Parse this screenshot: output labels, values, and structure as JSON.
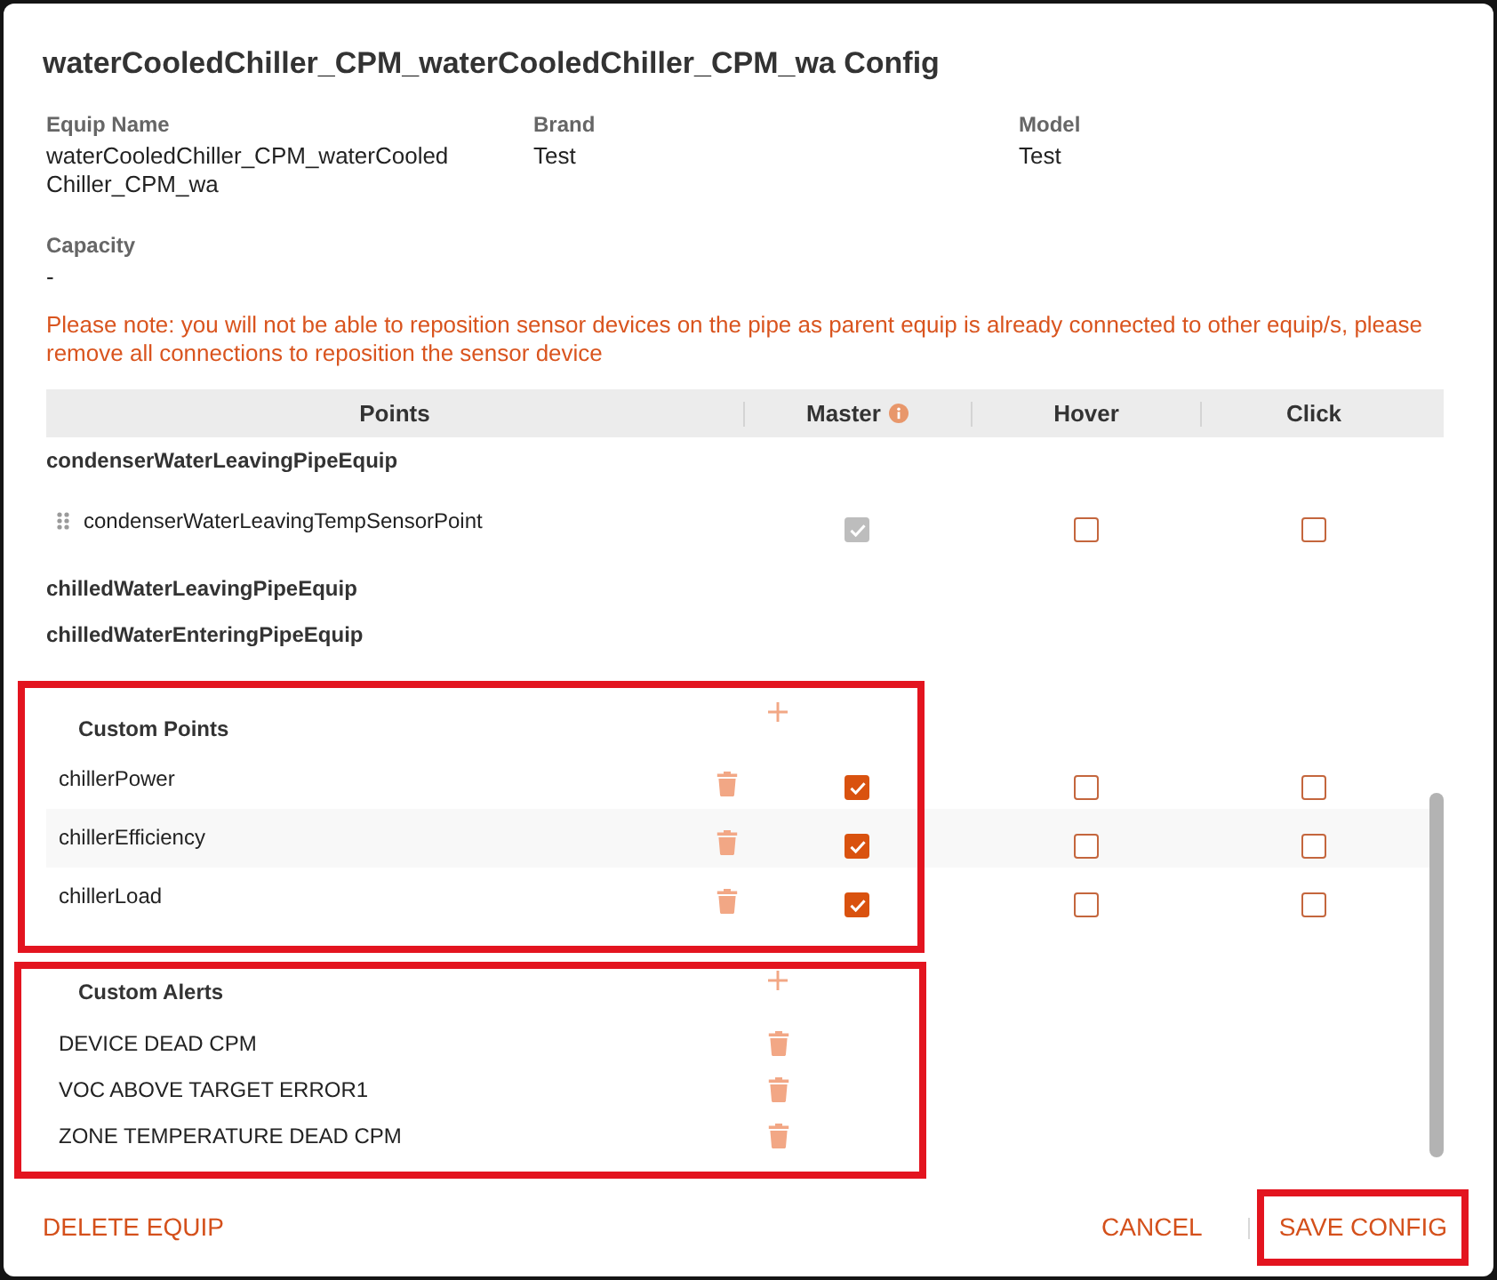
{
  "dialog": {
    "title": "waterCooledChiller_CPM_waterCooledChiller_CPM_wa Config"
  },
  "details": [
    {
      "label": "Equip Name",
      "value": "waterCooledChiller_CPM_waterCooledChiller_CPM_wa"
    },
    {
      "label": "Brand",
      "value": "Test"
    },
    {
      "label": "Model",
      "value": "Test"
    },
    {
      "label": "Capacity",
      "value": "-"
    }
  ],
  "warning": "Please note: you will not be able to reposition sensor devices on the pipe as parent equip is already connected to other equip/s, please remove all connections to reposition the sensor device",
  "table": {
    "columns": [
      {
        "label": "Points",
        "info": false
      },
      {
        "label": "Master",
        "info": true
      },
      {
        "label": "Hover",
        "info": false
      },
      {
        "label": "Click",
        "info": false
      }
    ],
    "groups": [
      {
        "name": "condenserWaterLeavingPipeEquip",
        "points": [
          {
            "name": "condenserWaterLeavingTempSensorPoint",
            "master": {
              "checked": true,
              "disabled": true
            },
            "hover": {
              "checked": false,
              "disabled": false
            },
            "click": {
              "checked": false,
              "disabled": false
            }
          }
        ]
      },
      {
        "name": "chilledWaterLeavingPipeEquip"
      },
      {
        "name": "chilledWaterEnteringPipeEquip"
      }
    ]
  },
  "custom_points": {
    "title": "Custom Points",
    "highlighted": true,
    "rows": [
      {
        "name": "chillerPower",
        "master": {
          "checked": true,
          "disabled": false
        },
        "hover": {
          "checked": false,
          "disabled": false
        },
        "click": {
          "checked": false,
          "disabled": false
        }
      },
      {
        "name": "chillerEfficiency",
        "master": {
          "checked": true,
          "disabled": false
        },
        "hover": {
          "checked": false,
          "disabled": false
        },
        "click": {
          "checked": false,
          "disabled": false
        }
      },
      {
        "name": "chillerLoad",
        "master": {
          "checked": true,
          "disabled": false
        },
        "hover": {
          "checked": false,
          "disabled": false
        },
        "click": {
          "checked": false,
          "disabled": false
        }
      }
    ]
  },
  "custom_alerts": {
    "title": "Custom Alerts",
    "highlighted": true,
    "rows": [
      {
        "name": "DEVICE DEAD CPM"
      },
      {
        "name": "VOC ABOVE TARGET ERROR1"
      },
      {
        "name": "ZONE TEMPERATURE DEAD CPM"
      }
    ]
  },
  "buttons": [
    {
      "label": "DELETE EQUIP",
      "highlighted": false
    },
    {
      "label": "CANCEL",
      "highlighted": false
    },
    {
      "label": "SAVE CONFIG",
      "highlighted": true
    }
  ]
}
